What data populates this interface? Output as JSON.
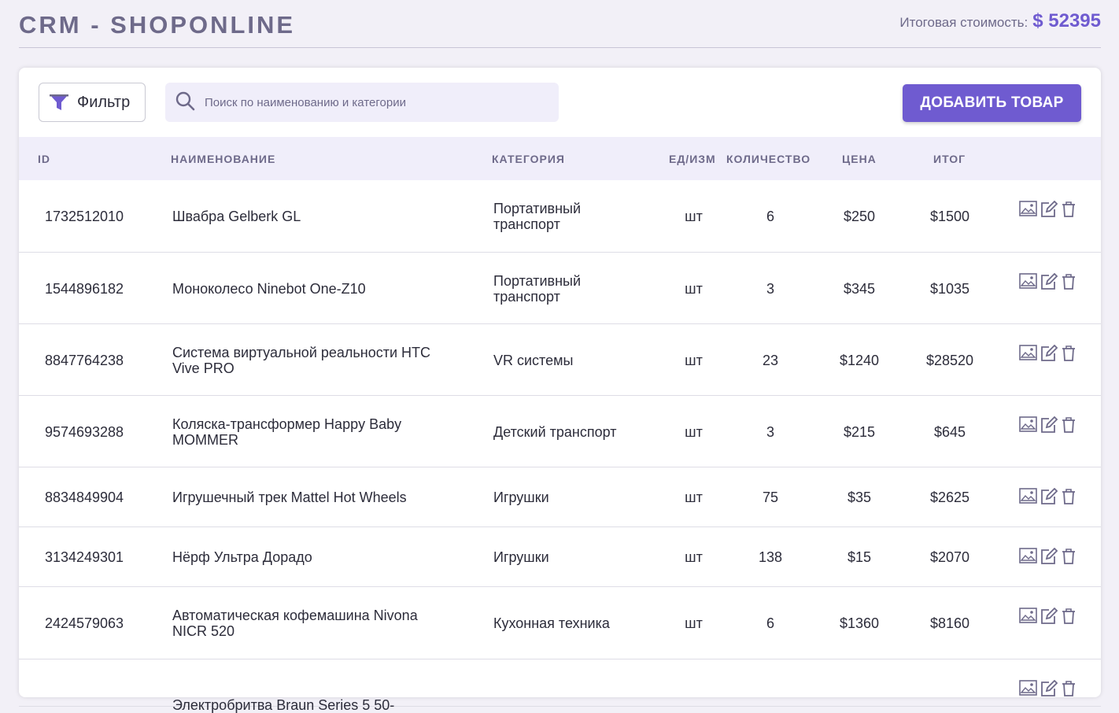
{
  "app": {
    "title": "CRM - SHOPONLINE",
    "total_label": "Итоговая стоимость:",
    "total_value": "$ 52395"
  },
  "toolbar": {
    "filter_label": "Фильтр",
    "search_placeholder": "Поиск по наименованию и категории",
    "search_value": "",
    "add_label": "ДОБАВИТЬ ТОВАР"
  },
  "table": {
    "headers": {
      "id": "ID",
      "name": "НАИМЕНОВАНИЕ",
      "category": "КАТЕГОРИЯ",
      "unit": "ЕД/ИЗМ",
      "qty": "КОЛИЧЕСТВО",
      "price": "ЦЕНА",
      "total": "ИТОГ"
    },
    "rows": [
      {
        "id": "1732512010",
        "name": "Швабра Gelberk GL",
        "category": "Портативный транспорт",
        "unit": "шт",
        "qty": "6",
        "price": "$250",
        "total": "$1500"
      },
      {
        "id": "1544896182",
        "name": "Моноколесо Ninebot One-Z10",
        "category": "Портативный транспорт",
        "unit": "шт",
        "qty": "3",
        "price": "$345",
        "total": "$1035"
      },
      {
        "id": "8847764238",
        "name": "Система виртуальной реальности HTC Vive PRO",
        "category": "VR системы",
        "unit": "шт",
        "qty": "23",
        "price": "$1240",
        "total": "$28520"
      },
      {
        "id": "9574693288",
        "name": "Коляска-трансформер Happy Baby MOMMER",
        "category": "Детский транспорт",
        "unit": "шт",
        "qty": "3",
        "price": "$215",
        "total": "$645"
      },
      {
        "id": "8834849904",
        "name": "Игрушечный трек Mattel Hot Wheels",
        "category": "Игрушки",
        "unit": "шт",
        "qty": "75",
        "price": "$35",
        "total": "$2625"
      },
      {
        "id": "3134249301",
        "name": "Нёрф Ультра Дорадо",
        "category": "Игрушки",
        "unit": "шт",
        "qty": "138",
        "price": "$15",
        "total": "$2070"
      },
      {
        "id": "2424579063",
        "name": "Автоматическая кофемашина Nivona NICR 520",
        "category": "Кухонная техника",
        "unit": "шт",
        "qty": "6",
        "price": "$1360",
        "total": "$8160"
      },
      {
        "id": "",
        "name": "Электробритва Braun Series 5 50-",
        "category": "",
        "unit": "",
        "qty": "",
        "price": "",
        "total": ""
      }
    ]
  },
  "colors": {
    "accent": "#6f5bd0",
    "muted": "#6e6a8a",
    "table_head_bg": "#f0eefa",
    "page_bg": "#f2f0f7"
  },
  "icons": [
    "filter-icon",
    "search-icon",
    "image-icon",
    "edit-icon",
    "delete-icon"
  ]
}
